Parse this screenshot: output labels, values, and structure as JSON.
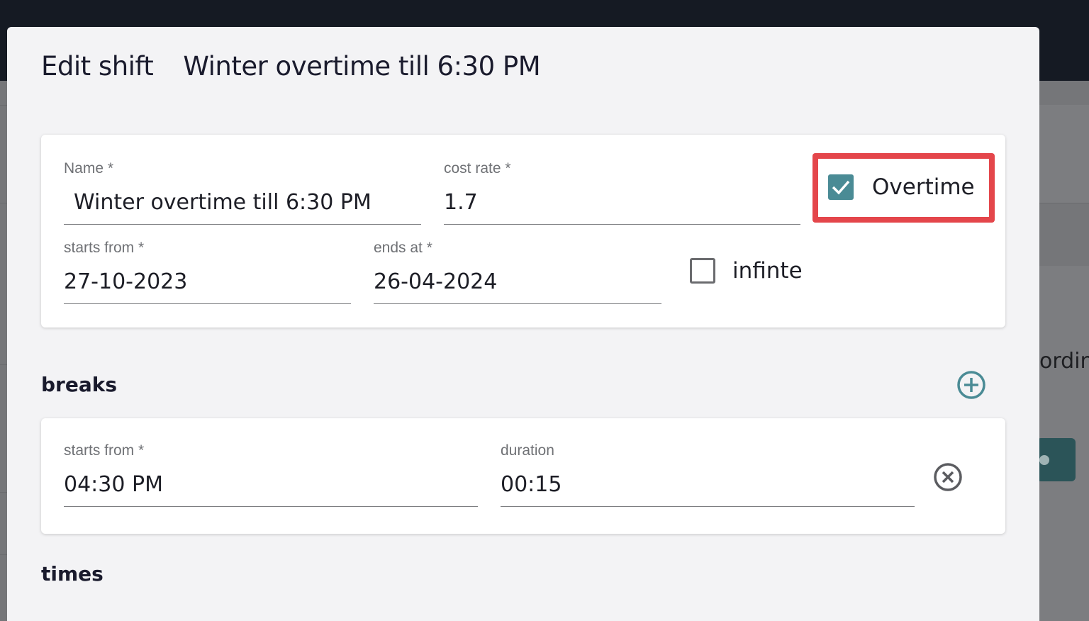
{
  "dialog": {
    "title": "Edit shift",
    "shift_name": "Winter overtime till 6:30 PM"
  },
  "main_card": {
    "name_label": "Name *",
    "name_value": "Winter overtime till 6:30 PM",
    "cost_rate_label": "cost rate *",
    "cost_rate_value": "1.7",
    "overtime_label": "Overtime",
    "overtime_checked": true,
    "starts_from_label": "starts from *",
    "starts_from_value": "27-10-2023",
    "ends_at_label": "ends at *",
    "ends_at_value": "26-04-2024",
    "infinite_label": "infinte",
    "infinite_checked": false
  },
  "breaks": {
    "title": "breaks",
    "items": [
      {
        "starts_from_label": "starts from *",
        "starts_from_value": "04:30 PM",
        "duration_label": "duration",
        "duration_value": "00:15"
      }
    ]
  },
  "times": {
    "title": "times"
  },
  "background": {
    "right_partial_text": "ordin"
  },
  "colors": {
    "accent": "#4a8b95",
    "highlight": "#e4464b",
    "topbar": "#151a23"
  }
}
